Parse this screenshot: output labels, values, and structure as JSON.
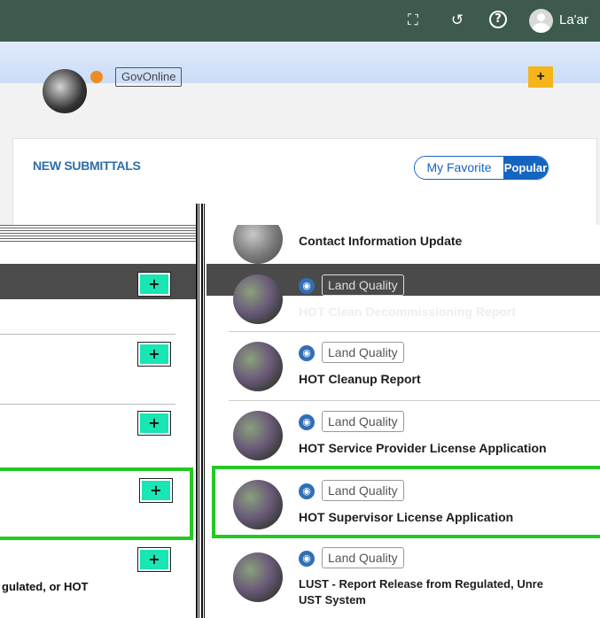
{
  "header": {
    "fullscreen_icon": "fullscreen-icon",
    "history_icon": "history-icon",
    "help_icon": "help-icon",
    "user_name": "La'ar"
  },
  "submittals": {
    "title": "NEW SUBMITTALS",
    "toggle": {
      "favorite_label": "My Favorite",
      "popular_label": "Popular"
    },
    "first_item_tag": "GovOnline",
    "plus": "+"
  },
  "left_list": {
    "plus_label": "+",
    "last_text": "gulated, or HOT"
  },
  "right_list": {
    "items": [
      {
        "tag": "",
        "title": "Contact Information Update"
      },
      {
        "tag": "Land Quality",
        "title": "HOT Clean Decommissioning Report"
      },
      {
        "tag": "Land Quality",
        "title": "HOT Cleanup Report"
      },
      {
        "tag": "Land Quality",
        "title": "HOT Service Provider License Application"
      },
      {
        "tag": "Land Quality",
        "title": "HOT Supervisor License Application"
      },
      {
        "tag": "Land Quality",
        "title": "LUST - Report Release from Regulated, Unre",
        "title_line2": "UST System"
      }
    ]
  },
  "colors": {
    "topbar": "#3d5a4c",
    "accent_blue": "#1565c0",
    "plus_green": "#18e6b4",
    "highlight_green": "#23c923",
    "card_plus_yellow": "#f5b418"
  }
}
